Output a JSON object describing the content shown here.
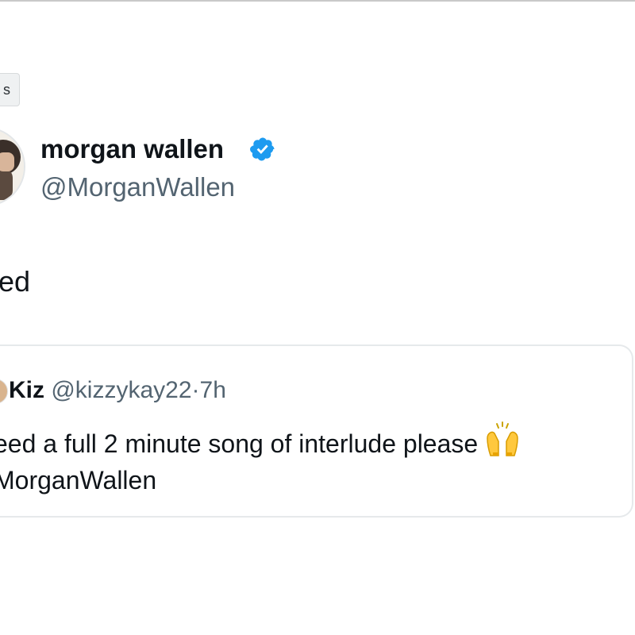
{
  "tag_button": {
    "label": "s"
  },
  "author": {
    "display_name": "morgan wallen",
    "handle": "@MorganWallen",
    "verified_icon": "verified-badge-icon"
  },
  "tweet": {
    "text": "ed"
  },
  "quote": {
    "author_name": "Kiz",
    "author_handle": "@kizzykay22",
    "separator": "·",
    "time": "7h",
    "text_line1": "eed a full 2 minute song of interlude please",
    "text_line2": "MorganWallen",
    "emoji_icon": "raising-hands-icon"
  },
  "colors": {
    "verified": "#1d9bf0",
    "secondary_text": "#536471",
    "border": "#e6e9eb"
  }
}
